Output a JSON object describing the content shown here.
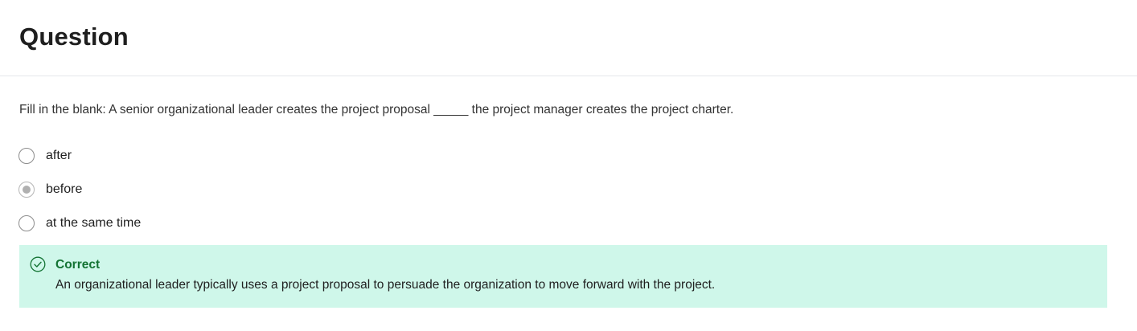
{
  "header": {
    "title": "Question"
  },
  "question": {
    "prompt": "Fill in the blank: A senior organizational leader creates the project proposal _____ the project manager creates the project charter."
  },
  "options": [
    {
      "label": "after",
      "selected": false
    },
    {
      "label": "before",
      "selected": true
    },
    {
      "label": "at the same time",
      "selected": false
    }
  ],
  "feedback": {
    "status": "Correct",
    "text": "An organizational leader typically uses a project proposal to persuade the organization to move forward with the project.",
    "icon": "check-circle-icon",
    "bg_color": "#cff7ea",
    "accent_color": "#137333"
  }
}
